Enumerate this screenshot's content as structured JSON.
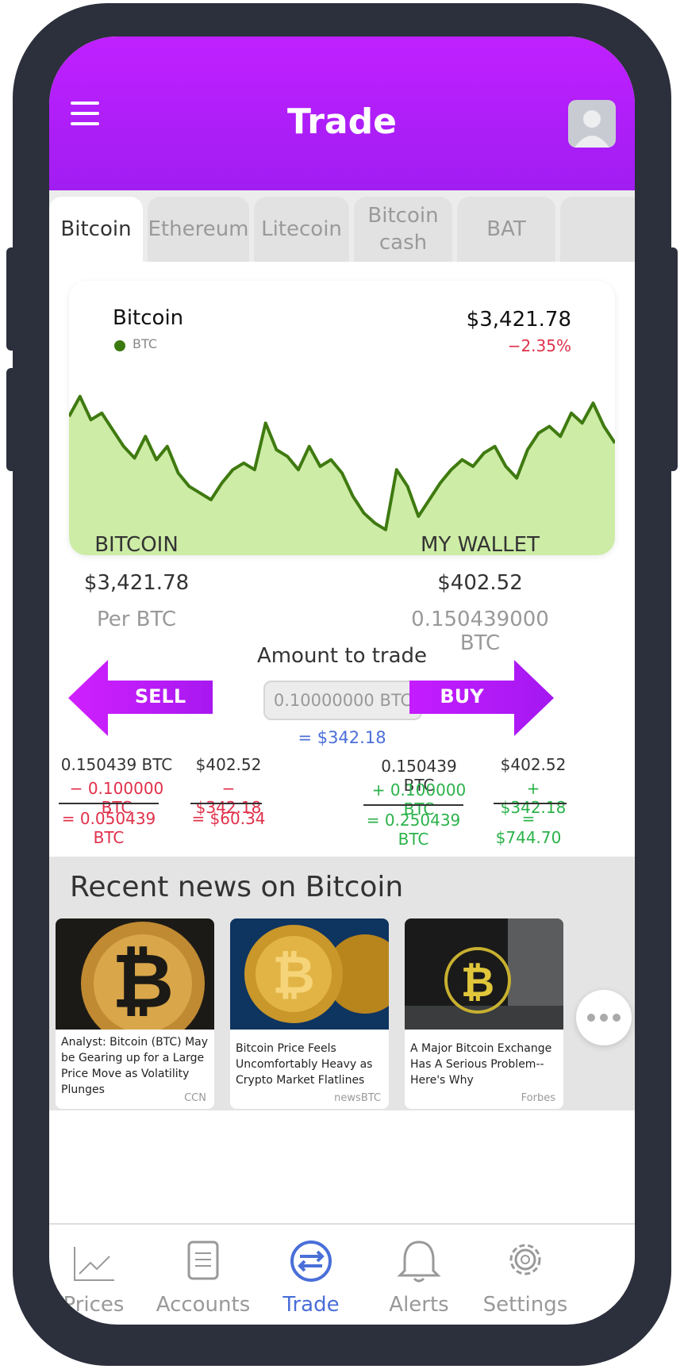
{
  "header": {
    "title": "Trade"
  },
  "tabs": [
    "Bitcoin",
    "Ethereum",
    "Litecoin",
    "Bitcoin cash",
    "BAT"
  ],
  "chart_card": {
    "name": "Bitcoin",
    "symbol": "BTC",
    "price": "$3,421.78",
    "change": "−2.35%",
    "colors": {
      "line": "#3f7a10",
      "fill": "#cdeca6"
    }
  },
  "chart_data": {
    "type": "area",
    "title": "",
    "series": [
      {
        "values": [
          70,
          82,
          68,
          72,
          62,
          52,
          45,
          58,
          44,
          52,
          36,
          28,
          24,
          20,
          30,
          38,
          42,
          38,
          66,
          50,
          46,
          38,
          52,
          40,
          44,
          36,
          22,
          12,
          6,
          2,
          38,
          28,
          10,
          20,
          30,
          38,
          44,
          40,
          48,
          52,
          40,
          33,
          50,
          60,
          64,
          58,
          72,
          66,
          78,
          64,
          54
        ]
      }
    ],
    "ylim": [
      0,
      100
    ],
    "grid": false
  },
  "stats": {
    "left": {
      "label": "BITCOIN",
      "value": "$3,421.78",
      "sub": "Per BTC"
    },
    "right": {
      "label": "MY WALLET",
      "value": "$402.52",
      "sub": "0.150439000 BTC"
    }
  },
  "trade": {
    "amount_label": "Amount to trade",
    "amount_value": "0.10000000 BTC",
    "amount_usd": "= $342.18",
    "sell_label": "SELL",
    "buy_label": "BUY"
  },
  "calc": {
    "sell_btc": [
      "0.150439 BTC",
      "− 0.100000 BTC",
      "= 0.050439 BTC"
    ],
    "sell_usd": [
      "$402.52",
      "− $342.18",
      "= $60.34"
    ],
    "buy_btc": [
      "0.150439 BTC",
      "+ 0.100000 BTC",
      "= 0.250439 BTC"
    ],
    "buy_usd": [
      "$402.52",
      "+ $342.18",
      "= $744.70"
    ]
  },
  "news": {
    "title": "Recent news on Bitcoin",
    "items": [
      {
        "headline": "Analyst: Bitcoin (BTC) May be Gearing up for a Large Price Move as Volatility Plunges",
        "source": "CCN"
      },
      {
        "headline": "Bitcoin Price Feels Uncomfortably Heavy as Crypto Market Flatlines",
        "source": "newsBTC"
      },
      {
        "headline": "A Major Bitcoin Exchange Has A Serious Problem-- Here's Why",
        "source": "Forbes"
      }
    ]
  },
  "nav": {
    "items": [
      {
        "label": "Prices",
        "icon": "chart-icon"
      },
      {
        "label": "Accounts",
        "icon": "document-icon"
      },
      {
        "label": "Trade",
        "icon": "swap-icon",
        "active": true
      },
      {
        "label": "Alerts",
        "icon": "bell-icon"
      },
      {
        "label": "Settings",
        "icon": "gear-icon"
      }
    ]
  }
}
